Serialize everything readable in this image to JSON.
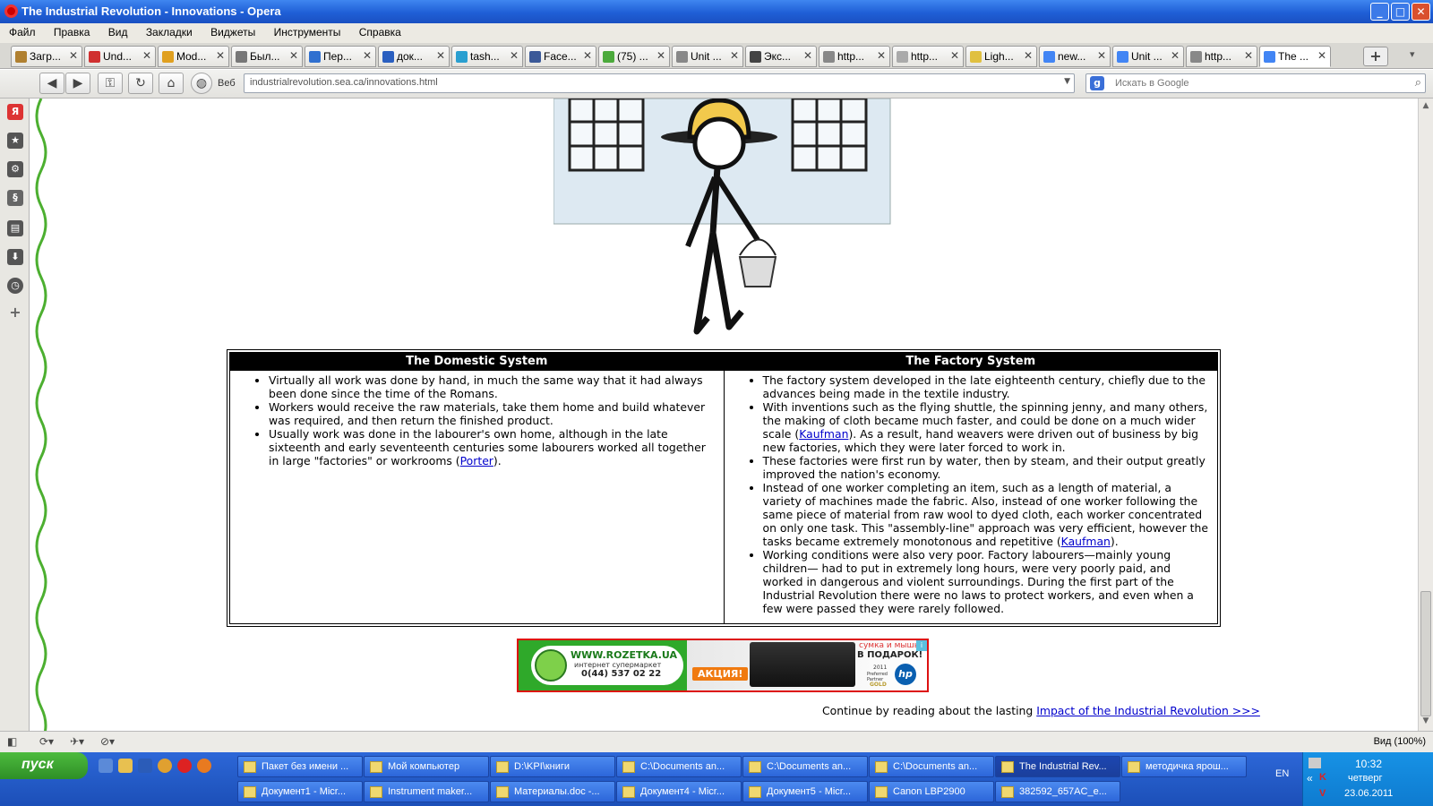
{
  "window": {
    "title": "The Industrial Revolution - Innovations - Opera"
  },
  "menu": [
    "Файл",
    "Правка",
    "Вид",
    "Закладки",
    "Виджеты",
    "Инструменты",
    "Справка"
  ],
  "tabs": [
    {
      "label": "Загр...",
      "icon_color": "#b08030",
      "icon": "document-icon"
    },
    {
      "label": "Und...",
      "icon_color": "#d03030",
      "icon": "site-icon"
    },
    {
      "label": "Mod...",
      "icon_color": "#e0a020",
      "icon": "site-icon"
    },
    {
      "label": "Был...",
      "icon_color": "#777777",
      "icon": "ex-icon"
    },
    {
      "label": "Пер...",
      "icon_color": "#3070d0",
      "icon": "translate-icon"
    },
    {
      "label": "док...",
      "icon_color": "#2a5fc0",
      "icon": "site-icon"
    },
    {
      "label": "tash...",
      "icon_color": "#2a9fd0",
      "icon": "site-icon"
    },
    {
      "label": "Face...",
      "icon_color": "#3b5998",
      "icon": "facebook-icon"
    },
    {
      "label": "(75) ...",
      "icon_color": "#4caa3c",
      "icon": "site-icon"
    },
    {
      "label": "Unit ...",
      "icon_color": "#888888",
      "icon": "page-icon"
    },
    {
      "label": "Экс...",
      "icon_color": "#444444",
      "icon": "grid-icon"
    },
    {
      "label": "http...",
      "icon_color": "#888888",
      "icon": "page-icon"
    },
    {
      "label": "http...",
      "icon_color": "#aaaaaa",
      "icon": "loading-icon"
    },
    {
      "label": "Ligh...",
      "icon_color": "#e0c040",
      "icon": "site-icon"
    },
    {
      "label": "new...",
      "icon_color": "#4285f4",
      "icon": "google-icon"
    },
    {
      "label": "Unit ...",
      "icon_color": "#4285f4",
      "icon": "google-icon"
    },
    {
      "label": "http...",
      "icon_color": "#888888",
      "icon": "page-icon"
    },
    {
      "label": "The ...",
      "icon_color": "#4285f4",
      "icon": "google-icon"
    }
  ],
  "toolbar": {
    "web_label": "Веб",
    "url": "industrialrevolution.sea.ca/innovations.html",
    "search_placeholder": "Искать в Google"
  },
  "page": {
    "domestic": {
      "header": "The Domestic System",
      "items": [
        {
          "text": "Virtually all work was done by hand, in much the same way that it had always been done since the time of the Romans."
        },
        {
          "text": "Workers would receive the raw materials, take them home and build whatever was required, and then return the finished product."
        },
        {
          "pre": "Usually work was done in the labourer's own home, although in the late sixteenth and early seventeenth centuries some labourers worked all together in large \"factories\" or workrooms (",
          "link": "Porter",
          "post": ")."
        }
      ]
    },
    "factory": {
      "header": "The Factory System",
      "items": [
        {
          "text": "The factory system developed in the late eighteenth century, chiefly due to the advances being made in the textile industry."
        },
        {
          "pre": "With inventions such as the flying shuttle, the spinning jenny, and many others, the making of cloth became much faster, and could be done on a much wider scale (",
          "link": "Kaufman",
          "post": "). As a result, hand weavers were driven out of business by big new factories, which they were later forced to work in."
        },
        {
          "text": "These factories were first run by water, then by steam, and their output greatly improved the nation's economy."
        },
        {
          "pre": "Instead of one worker completing an item, such as a length of material, a variety of machines made the fabric. Also, instead of one worker following the same piece of material from raw wool to dyed cloth, each worker concentrated on only one task. This \"assembly-line\" approach was very efficient, however the tasks became extremely monotonous and repetitive (",
          "link": "Kaufman",
          "post": ")."
        },
        {
          "text": "Working conditions were also very poor. Factory labourers—mainly young children— had to put in extremely long hours, were very poorly paid, and worked in dangerous and violent surroundings. During the first part of the Industrial Revolution there were no laws to protect workers, and even when a few were passed they were rarely followed."
        }
      ]
    },
    "ad": {
      "site": "WWW.ROZETKA.UA",
      "tagline": "интернет супермаркет",
      "phone": "0(44) 537 02 22",
      "promo": "АКЦИЯ!",
      "gift": "сумка и мышь",
      "gift2": "В ПОДАРОК!",
      "year": "2011",
      "partner": "Preferred Partner",
      "gold": "GOLD",
      "brand": "hp"
    },
    "continue": {
      "text": "Continue by reading about the lasting ",
      "link": "Impact of the Industrial Revolution >>>"
    }
  },
  "status": {
    "zoom": "Вид (100%)"
  },
  "taskbar": {
    "start": "пуск",
    "row1": [
      "Пакет без имени ...",
      "Мой компьютер",
      "D:\\KPI\\книги",
      "C:\\Documents an...",
      "C:\\Documents an...",
      "C:\\Documents an...",
      "The Industrial Rev...",
      "методичка ярош..."
    ],
    "row2": [
      "Документ1 - Micr...",
      "Instrument maker...",
      "Материалы.doc -...",
      "Документ4 - Micr...",
      "Документ5 - Micr...",
      "Canon LBP2900",
      "382592_657AC_e..."
    ],
    "lang": "EN",
    "time": "10:32",
    "day": "четверг",
    "date": "23.06.2011"
  }
}
